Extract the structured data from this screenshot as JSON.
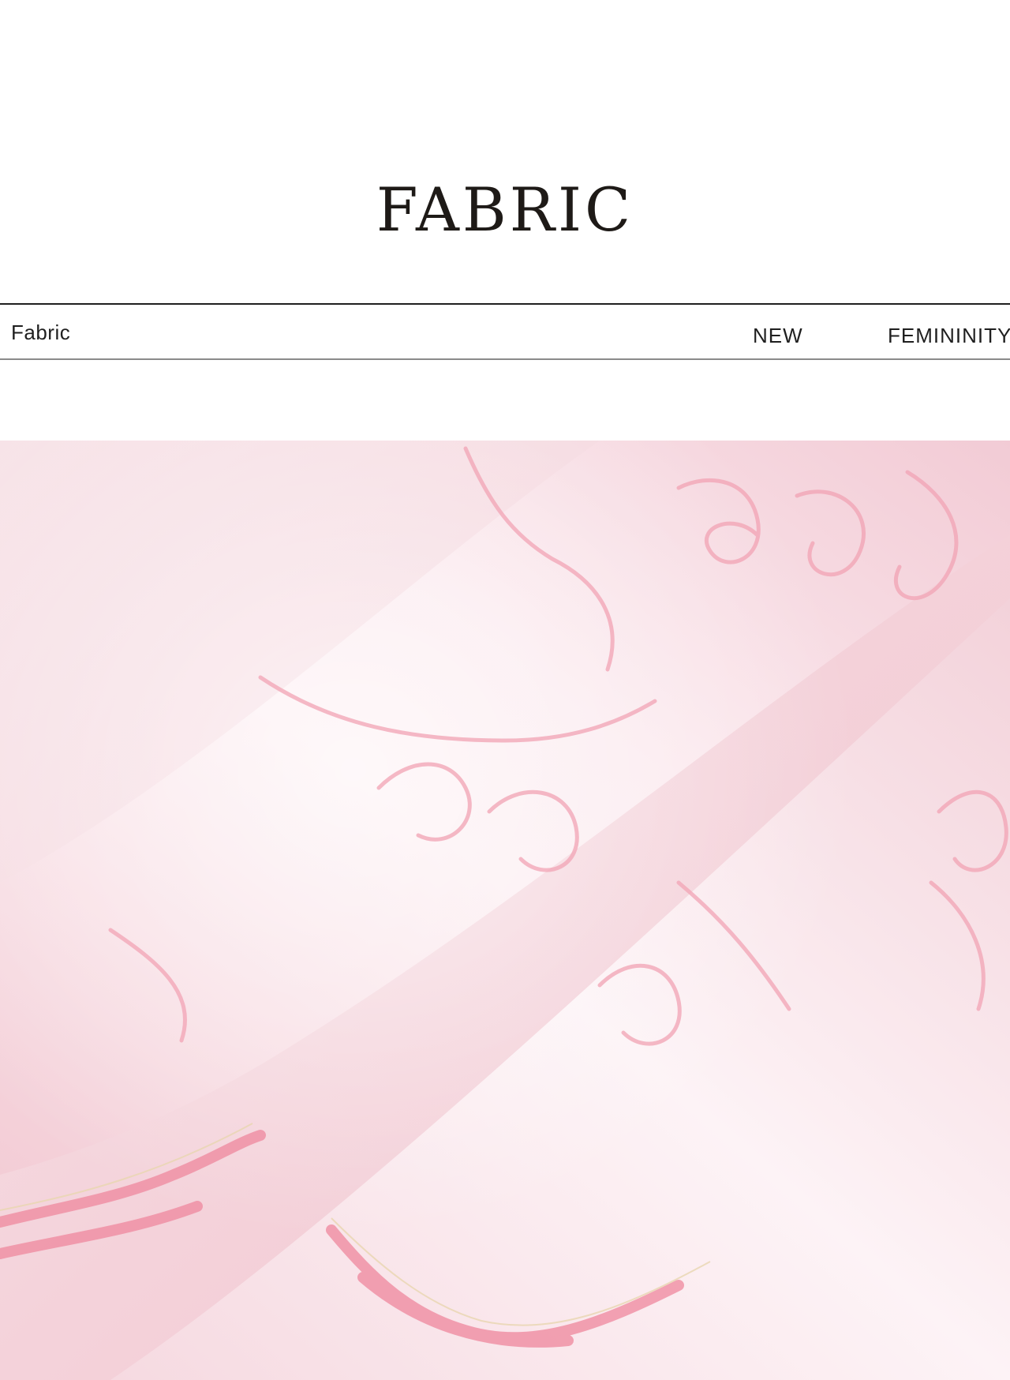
{
  "heading": {
    "title": "FABRIC"
  },
  "info_bar": {
    "left_label": "Fabric",
    "tag_1": "NEW",
    "tag_2": "FEMININITY"
  },
  "photo": {
    "subject": "fabric-closeup-image",
    "colors": {
      "base": "#f4d7dd",
      "highlight": "#fdf1f4",
      "pattern": "#f2a3b4",
      "accent": "#f08da2"
    }
  }
}
